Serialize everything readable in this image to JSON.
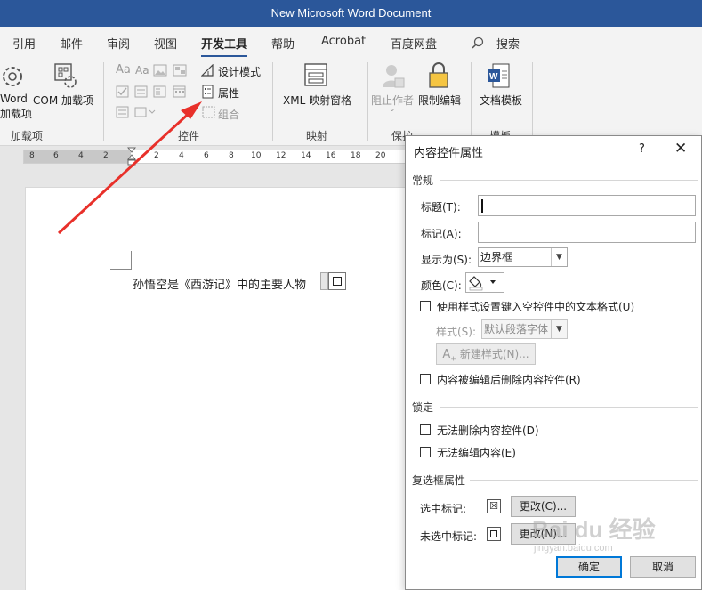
{
  "window": {
    "title": "New Microsoft Word Document"
  },
  "tabs": [
    "引用",
    "邮件",
    "审阅",
    "视图",
    "开发工具",
    "帮助",
    "Acrobat",
    "百度网盘"
  ],
  "active_tab": "开发工具",
  "search": {
    "label": "搜索"
  },
  "ribbon": {
    "addins": {
      "word_addins_line1": "Word",
      "word_addins_line2": "加载项",
      "com_addins": "COM 加载项",
      "group_label": "加载项"
    },
    "controls": {
      "design_mode": "设计模式",
      "properties": "属性",
      "group": "组合",
      "group_label": "控件"
    },
    "mapping": {
      "xml_pane": "XML 映射窗格",
      "group_label": "映射"
    },
    "protect": {
      "block_authors": "阻止作者",
      "restrict_editing": "限制编辑",
      "group_label": "保护"
    },
    "templates": {
      "document_template": "文档模板",
      "group_label": "模板"
    }
  },
  "ruler": {
    "numbers": [
      "8",
      "6",
      "4",
      "2",
      "2",
      "4",
      "6",
      "8",
      "10",
      "12",
      "14",
      "16",
      "18",
      "20"
    ]
  },
  "document": {
    "text": "孙悟空是《西游记》中的主要人物"
  },
  "dialog": {
    "title": "内容控件属性",
    "help": "?",
    "close": "✕",
    "general": {
      "section": "常规",
      "title_label": "标题(T):",
      "title_value": "",
      "tag_label": "标记(A):",
      "tag_value": "",
      "show_as_label": "显示为(S):",
      "show_as_value": "边界框",
      "color_label": "颜色(C):",
      "use_style_label": "使用样式设置键入空控件中的文本格式(U)",
      "style_label": "样式(S):",
      "style_value": "默认段落字体",
      "new_style_button": "新建样式(N)...",
      "remove_label": "内容被编辑后删除内容控件(R)"
    },
    "locking": {
      "section": "锁定",
      "cannot_delete": "无法删除内容控件(D)",
      "cannot_edit": "无法编辑内容(E)"
    },
    "checkbox": {
      "section": "复选框属性",
      "checked_label": "选中标记:",
      "checked_symbol": "☒",
      "unchecked_label": "未选中标记:",
      "change_checked": "更改(C)...",
      "change_unchecked": "更改(N)..."
    },
    "ok_button": "确定",
    "cancel_button": "取消"
  },
  "watermark": {
    "text": "Bai du 经验",
    "sub": "jingyan.baidu.com"
  },
  "colors": {
    "accent": "#2b579a",
    "arrow": "#e8302a"
  }
}
